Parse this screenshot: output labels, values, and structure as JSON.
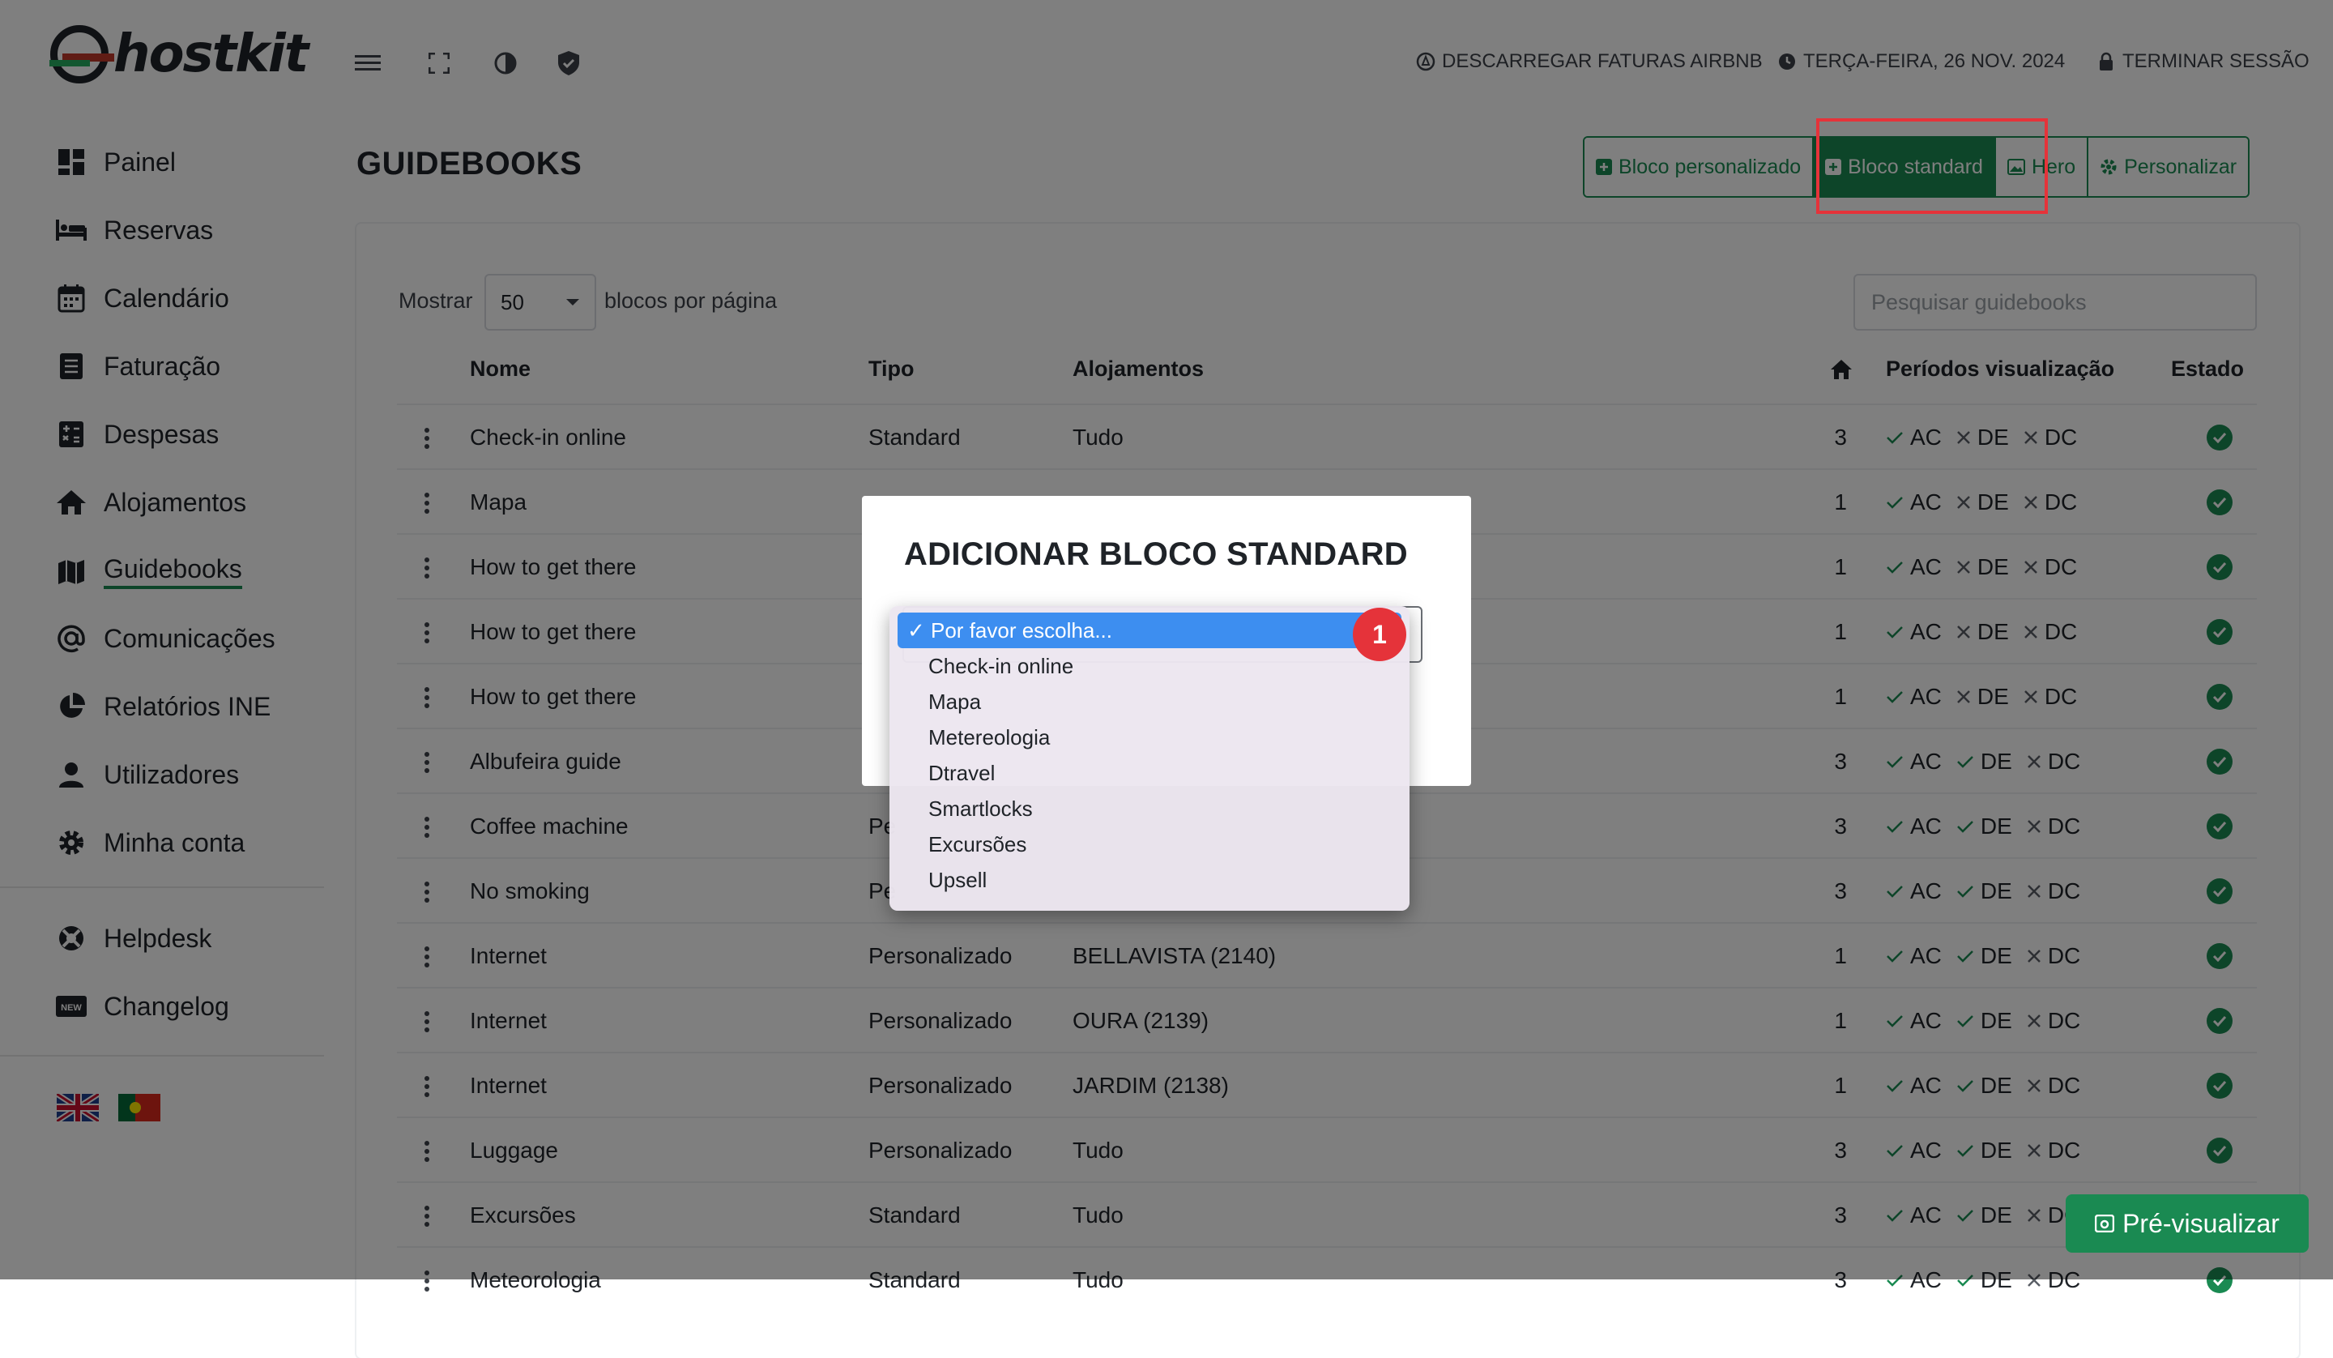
{
  "brand": {
    "name": "hostkit"
  },
  "topbar": {
    "airbnb": "DESCARREGAR FATURAS AIRBNB",
    "date": "TERÇA-FEIRA, 26 NOV. 2024",
    "logout": "TERMINAR SESSÃO"
  },
  "sidebar": {
    "items": [
      {
        "label": "Painel",
        "icon": "dashboard-icon"
      },
      {
        "label": "Reservas",
        "icon": "bed-icon"
      },
      {
        "label": "Calendário",
        "icon": "calendar-icon"
      },
      {
        "label": "Faturação",
        "icon": "invoice-icon"
      },
      {
        "label": "Despesas",
        "icon": "calculator-icon"
      },
      {
        "label": "Alojamentos",
        "icon": "home-icon"
      },
      {
        "label": "Guidebooks",
        "icon": "map-icon",
        "active": true
      },
      {
        "label": "Comunicações",
        "icon": "at-icon"
      },
      {
        "label": "Relatórios INE",
        "icon": "pie-chart-icon"
      },
      {
        "label": "Utilizadores",
        "icon": "user-icon"
      },
      {
        "label": "Minha conta",
        "icon": "gear-icon"
      }
    ],
    "secondary": [
      {
        "label": "Helpdesk",
        "icon": "lifebuoy-icon"
      },
      {
        "label": "Changelog",
        "icon": "new-badge-icon"
      }
    ],
    "new_badge": "NEW"
  },
  "page": {
    "title": "GUIDEBOOKS",
    "buttons": {
      "custom_block": "Bloco personalizado",
      "standard_block": "Bloco standard",
      "hero": "Hero",
      "customize": "Personalizar"
    }
  },
  "table": {
    "show_label": "Mostrar",
    "per_page_value": "50",
    "per_page_suffix": "blocos por página",
    "search_placeholder": "Pesquisar guidebooks",
    "headers": {
      "name": "Nome",
      "type": "Tipo",
      "lodgings": "Alojamentos",
      "periods": "Períodos visualização",
      "state": "Estado"
    },
    "period_codes": [
      "AC",
      "DE",
      "DC"
    ],
    "rows": [
      {
        "name": "Check-in online",
        "type": "Standard",
        "lodging": "Tudo",
        "count": "3",
        "periods": [
          true,
          false,
          false
        ]
      },
      {
        "name": "Mapa",
        "type": "",
        "lodging": "",
        "count": "1",
        "periods": [
          true,
          false,
          false
        ]
      },
      {
        "name": "How to get there",
        "type": "",
        "lodging": "",
        "count": "1",
        "periods": [
          true,
          false,
          false
        ]
      },
      {
        "name": "How to get there",
        "type": "",
        "lodging": "",
        "count": "1",
        "periods": [
          true,
          false,
          false
        ]
      },
      {
        "name": "How to get there",
        "type": "",
        "lodging": "",
        "count": "1",
        "periods": [
          true,
          false,
          false
        ]
      },
      {
        "name": "Albufeira guide",
        "type": "",
        "lodging": "",
        "count": "3",
        "periods": [
          true,
          true,
          false
        ]
      },
      {
        "name": "Coffee machine",
        "type": "Pe",
        "lodging": "",
        "count": "3",
        "periods": [
          true,
          true,
          false
        ]
      },
      {
        "name": "No smoking",
        "type": "Pe",
        "lodging": "",
        "count": "3",
        "periods": [
          true,
          true,
          false
        ]
      },
      {
        "name": "Internet",
        "type": "Personalizado",
        "lodging": "BELLAVISTA (2140)",
        "count": "1",
        "periods": [
          true,
          true,
          false
        ]
      },
      {
        "name": "Internet",
        "type": "Personalizado",
        "lodging": "OURA (2139)",
        "count": "1",
        "periods": [
          true,
          true,
          false
        ]
      },
      {
        "name": "Internet",
        "type": "Personalizado",
        "lodging": "JARDIM (2138)",
        "count": "1",
        "periods": [
          true,
          true,
          false
        ]
      },
      {
        "name": "Luggage",
        "type": "Personalizado",
        "lodging": "Tudo",
        "count": "3",
        "periods": [
          true,
          true,
          false
        ]
      },
      {
        "name": "Excursões",
        "type": "Standard",
        "lodging": "Tudo",
        "count": "3",
        "periods": [
          true,
          true,
          false
        ]
      },
      {
        "name": "Meteorologia",
        "type": "Standard",
        "lodging": "Tudo",
        "count": "3",
        "periods": [
          true,
          true,
          false
        ]
      }
    ]
  },
  "modal": {
    "title": "ADICIONAR BLOCO STANDARD",
    "options": [
      "Por favor escolha...",
      "Check-in online",
      "Mapa",
      "Metereologia",
      "Dtravel",
      "Smartlocks",
      "Excursões",
      "Upsell"
    ],
    "selected_index": 0,
    "selected_mark": "✓"
  },
  "annotation": {
    "step": "1"
  },
  "preview_button": "Pré-visualizar",
  "colors": {
    "accent": "#1a8a52",
    "highlight": "#e5333a",
    "select_blue": "#3d8ef0"
  }
}
